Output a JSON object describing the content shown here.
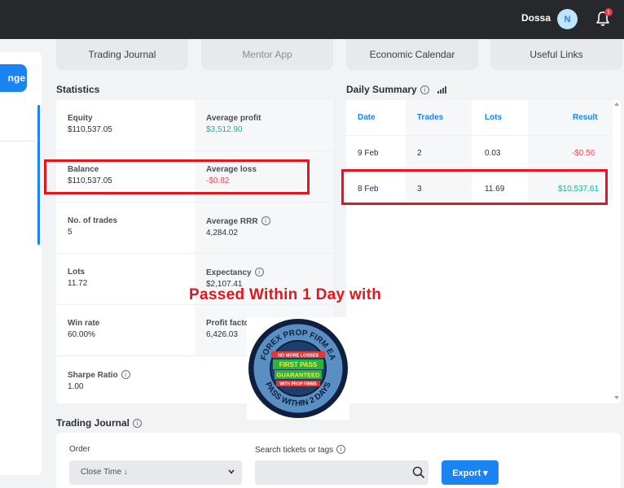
{
  "header": {
    "user_name": "Dossa",
    "avatar_initial": "N",
    "notification_count": "1"
  },
  "sidebar": {
    "button_label": "nge"
  },
  "tabs": [
    "Trading Journal",
    "Mentor App",
    "Economic Calendar",
    "Useful Links"
  ],
  "statistics": {
    "title": "Statistics",
    "cells": [
      {
        "label": "Equity",
        "value": "$110,537.05"
      },
      {
        "label": "Average profit",
        "value": "$3,512.90"
      },
      {
        "label": "Balance",
        "value": "$110,537.05"
      },
      {
        "label": "Average loss",
        "value": "-$0.82"
      },
      {
        "label": "No. of trades",
        "value": "5"
      },
      {
        "label": "Average RRR",
        "value": "4,284.02"
      },
      {
        "label": "Lots",
        "value": "11.72"
      },
      {
        "label": "Expectancy",
        "value": "$2,107.41"
      },
      {
        "label": "Win rate",
        "value": "60.00%"
      },
      {
        "label": "Profit facto",
        "value": "6,426.03"
      },
      {
        "label": "Sharpe Ratio",
        "value": "1.00"
      }
    ]
  },
  "daily_summary": {
    "title": "Daily Summary",
    "columns": [
      "Date",
      "Trades",
      "Lots",
      "Result"
    ],
    "rows": [
      {
        "date": "9 Feb",
        "trades": "2",
        "lots": "0.03",
        "result": "-$0.56"
      },
      {
        "date": "8 Feb",
        "trades": "3",
        "lots": "11.69",
        "result": "$10,537.61"
      }
    ]
  },
  "overlay": {
    "headline": "Passed Within 1 Day with",
    "badge_top": "FOREX PROP FIRM EA",
    "badge_bottom": "PASS WITHIN 2 DAYS",
    "badge_line1": "NO MORE LOSSES",
    "badge_line2": "FIRST PASS",
    "badge_line3": "GUARANTEED",
    "badge_line4": "WITH PROP FIRMS"
  },
  "journal": {
    "title": "Trading Journal",
    "order_label": "Order",
    "order_value": "Close Time ↓",
    "search_label": "Search tickets or tags",
    "search_placeholder": "",
    "export_label": "Export ▾"
  },
  "colors": {
    "accent": "#1a84f2",
    "positive": "#17b39a",
    "negative": "#f0485a",
    "highlight": "#e8141c"
  }
}
